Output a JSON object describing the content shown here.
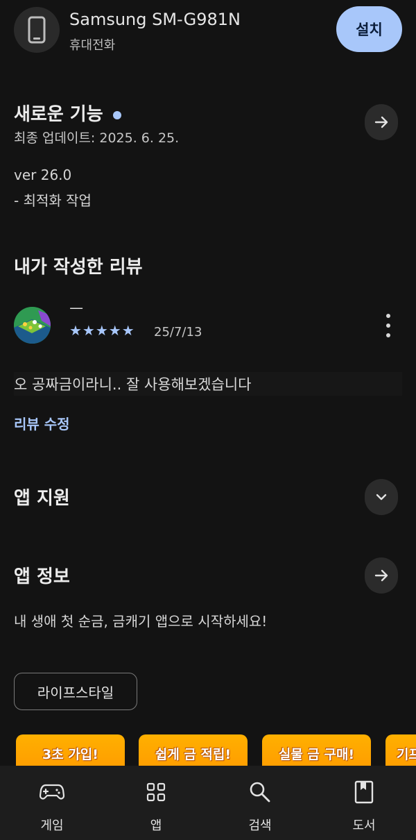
{
  "header": {
    "device_name": "Samsung SM-G981N",
    "device_type": "휴대전화",
    "install_label": "설치",
    "device_icon": "phone-icon"
  },
  "whats_new": {
    "title": "새로운 기능",
    "updated": "최종 업데이트: 2025. 6. 25.",
    "version": "ver 26.0",
    "note": "- 최적화 작업"
  },
  "my_review": {
    "title": "내가 작성한 리뷰",
    "reviewer": "ㅡ",
    "rating": 5,
    "stars": "★★★★★",
    "date": "25/7/13",
    "text": "오 공짜금이라니.. 잘 사용해보겠습니다",
    "edit_label": "리뷰 수정"
  },
  "app_support": {
    "title": "앱 지원"
  },
  "app_info": {
    "title": "앱 정보",
    "description": "내 생애 첫 순금, 금캐기 앱으로 시작하세요!",
    "category": "라이프스타일"
  },
  "promos": [
    "3초 가입!",
    "쉽게 금 적립!",
    "실물 금 구매!",
    "기프"
  ],
  "bottom_nav": [
    {
      "label": "게임",
      "icon": "gamepad-icon"
    },
    {
      "label": "앱",
      "icon": "apps-grid-icon"
    },
    {
      "label": "검색",
      "icon": "search-icon"
    },
    {
      "label": "도서",
      "icon": "book-icon"
    }
  ],
  "colors": {
    "accent": "#a8c7fa",
    "background": "#131313",
    "promo": "#ffa800"
  }
}
